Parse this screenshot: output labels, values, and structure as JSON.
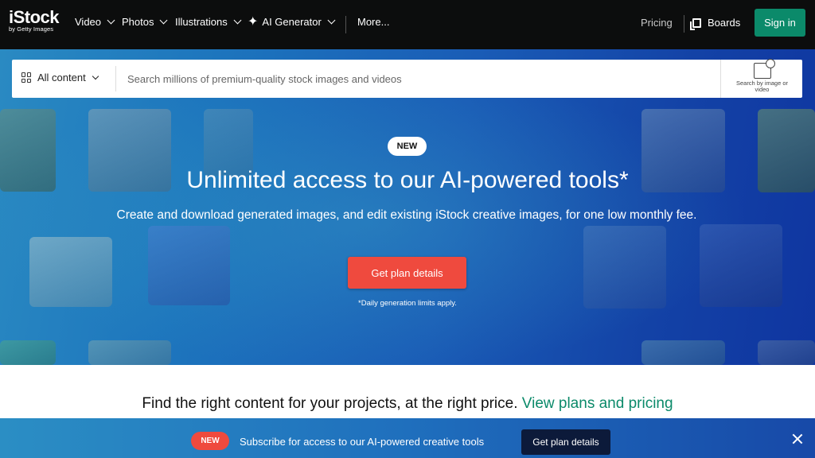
{
  "nav": {
    "logo_main": "iStock",
    "logo_sub": "by Getty Images",
    "items": [
      {
        "label": "Video"
      },
      {
        "label": "Photos"
      },
      {
        "label": "Illustrations"
      },
      {
        "label": "AI Generator"
      },
      {
        "label": "More..."
      }
    ],
    "pricing": "Pricing",
    "boards": "Boards",
    "signin": "Sign in"
  },
  "search": {
    "scope": "All content",
    "placeholder": "Search millions of premium-quality stock images and videos",
    "by_image_label": "Search by image or video"
  },
  "hero": {
    "badge": "NEW",
    "title": "Unlimited access to our AI-powered tools*",
    "subtitle": "Create and download generated images, and edit existing iStock creative images, for one low monthly fee.",
    "button": "Get plan details",
    "note": "*Daily generation limits apply."
  },
  "section": {
    "text": "Find the right content for your projects, at the right price.",
    "link": "View plans and pricing"
  },
  "banner": {
    "badge": "NEW",
    "text": "Subscribe for access to our AI-powered creative tools",
    "button": "Get plan details"
  },
  "colors": {
    "nav_bg": "#0c0d0d",
    "accent_green": "#0b8a6a",
    "cta_red": "#ef4a3e",
    "hero_blue": "#1a5cb6"
  }
}
